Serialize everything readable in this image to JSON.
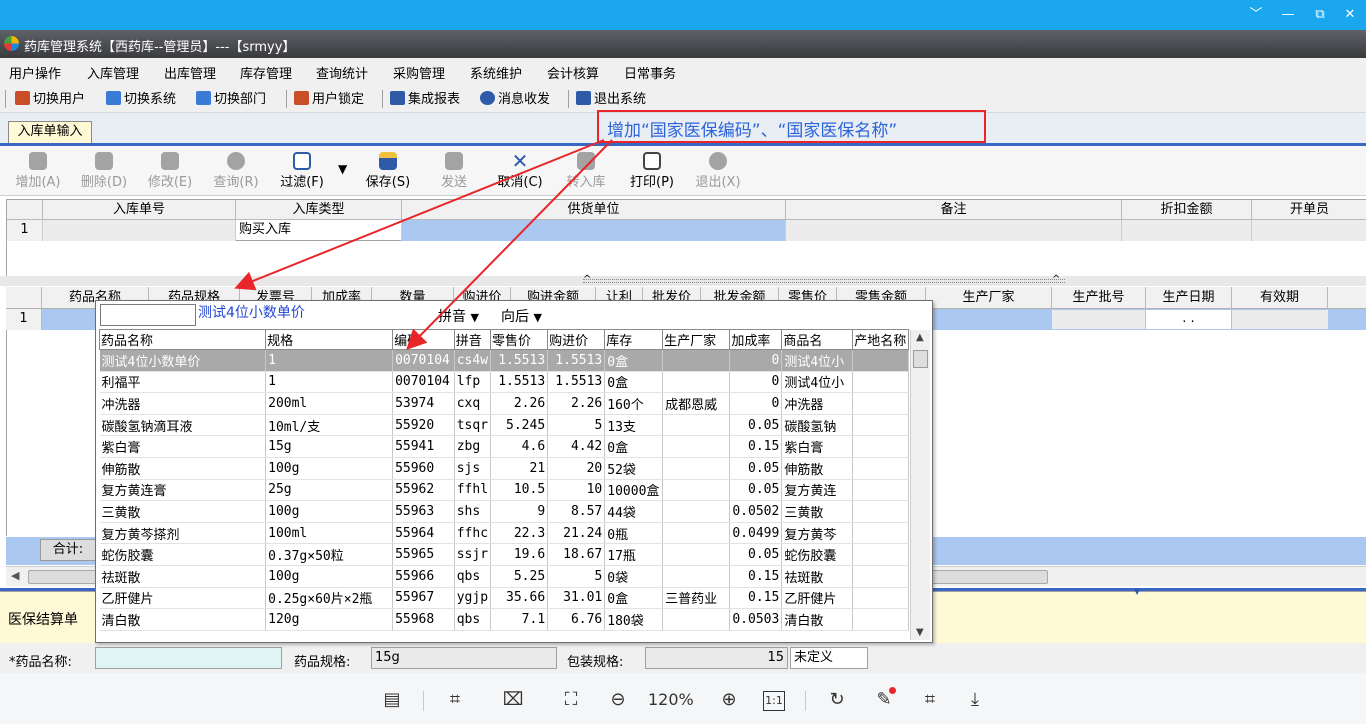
{
  "viewer": {
    "window_controls": [
      "﹀",
      "—",
      "⧉",
      "✕"
    ],
    "zoom": "120%",
    "one_to_one": "1:1"
  },
  "app": {
    "title": "药库管理系统【西药库--管理员】---【srmyy】"
  },
  "menu": [
    "用户操作",
    "入库管理",
    "出库管理",
    "库存管理",
    "查询统计",
    "采购管理",
    "系统维护",
    "会计核算",
    "日常事务"
  ],
  "quickbar": [
    {
      "label": "切换用户",
      "icon": "users-icon",
      "color": "#c94f28"
    },
    {
      "label": "切换系统",
      "icon": "switch-system-icon",
      "color": "#3a7bd5"
    },
    {
      "label": "切换部门",
      "icon": "department-icon",
      "color": "#3a7bd5"
    },
    {
      "label": "用户锁定",
      "icon": "user-lock-icon",
      "color": "#c94f28"
    },
    {
      "label": "集成报表",
      "icon": "report-icon",
      "color": "#2e5aa8"
    },
    {
      "label": "消息收发",
      "icon": "message-icon",
      "color": "#2e5aa8"
    },
    {
      "label": "退出系统",
      "icon": "exit-icon",
      "color": "#2e5aa8"
    }
  ],
  "tab": {
    "label": "入库单输入"
  },
  "annotation": {
    "text": "增加“国家医保编码”、“国家医保名称”",
    "color": "#e8262a"
  },
  "toolbar": [
    {
      "label": "增加(A)",
      "enabled": false,
      "icon": "add-icon"
    },
    {
      "label": "删除(D)",
      "enabled": false,
      "icon": "delete-icon"
    },
    {
      "label": "修改(E)",
      "enabled": false,
      "icon": "edit-icon"
    },
    {
      "label": "查询(R)",
      "enabled": false,
      "icon": "refresh-icon"
    },
    {
      "label": "过滤(F)",
      "enabled": true,
      "icon": "filter-icon"
    },
    {
      "label": "保存(S)",
      "enabled": true,
      "icon": "save-icon"
    },
    {
      "label": "发送",
      "enabled": false,
      "icon": "send-icon"
    },
    {
      "label": "取消(C)",
      "enabled": true,
      "icon": "cancel-icon"
    },
    {
      "label": "转入库",
      "enabled": false,
      "icon": "transfer-icon"
    },
    {
      "label": "打印(P)",
      "enabled": true,
      "icon": "print-icon"
    },
    {
      "label": "退出(X)",
      "enabled": false,
      "icon": "exit-icon"
    }
  ],
  "header_grid": {
    "columns": [
      "入库单号",
      "入库类型",
      "供货单位",
      "备注",
      "折扣金额",
      "开单员"
    ],
    "row": {
      "num": "1",
      "type": "购买入库"
    }
  },
  "detail_grid": {
    "columns": [
      "药品名称",
      "药品规格",
      "发票号",
      "加成率",
      "数量",
      "购进价",
      "购进金额",
      "让利",
      "批发价",
      "批发金额",
      "零售价",
      "零售金额",
      "生产厂家",
      "生产批号",
      "生产日期",
      "有效期"
    ],
    "row_num": "1",
    "date_placeholder": ". .",
    "total_label": "合计:"
  },
  "popup": {
    "caption": "测试4位小数单价",
    "pinyin_mode": "拼音",
    "direction": "向后",
    "columns": [
      "药品名称",
      "规格",
      "编码",
      "拼音",
      "零售价",
      "购进价",
      "库存",
      "生产厂家",
      "加成率",
      "商品名",
      "产地名称"
    ],
    "rows": [
      [
        "测试4位小数单价",
        "1",
        "0070104",
        "cs4w",
        "1.5513",
        "1.5513",
        "0盒",
        "",
        "0",
        "测试4位小",
        ""
      ],
      [
        "利福平",
        "1",
        "0070104",
        "lfp",
        "1.5513",
        "1.5513",
        "0盒",
        "",
        "0",
        "测试4位小",
        ""
      ],
      [
        "冲洗器",
        "200ml",
        "53974",
        "cxq",
        "2.26",
        "2.26",
        "160个",
        "成都恩威",
        "0",
        "冲洗器",
        ""
      ],
      [
        "碳酸氢钠滴耳液",
        "10ml/支",
        "55920",
        "tsqr",
        "5.245",
        "5",
        "13支",
        "",
        "0.05",
        "碳酸氢钠",
        ""
      ],
      [
        "紫白膏",
        "15g",
        "55941",
        "zbg",
        "4.6",
        "4.42",
        "0盒",
        "",
        "0.15",
        "紫白膏",
        ""
      ],
      [
        "伸筋散",
        "100g",
        "55960",
        "sjs",
        "21",
        "20",
        "52袋",
        "",
        "0.05",
        "伸筋散",
        ""
      ],
      [
        "复方黄连膏",
        "25g",
        "55962",
        "ffhl",
        "10.5",
        "10",
        "10000盒",
        "",
        "0.05",
        "复方黄连",
        ""
      ],
      [
        "三黄散",
        "100g",
        "55963",
        "shs",
        "9",
        "8.57",
        "44袋",
        "",
        "0.0502",
        "三黄散",
        ""
      ],
      [
        "复方黄芩搽剂",
        "100ml",
        "55964",
        "ffhc",
        "22.3",
        "21.24",
        "0瓶",
        "",
        "0.0499",
        "复方黄芩",
        ""
      ],
      [
        "蛇伤胶囊",
        "0.37g×50粒",
        "55965",
        "ssjr",
        "19.6",
        "18.67",
        "17瓶",
        "",
        "0.05",
        "蛇伤胶囊",
        ""
      ],
      [
        "祛斑散",
        "100g",
        "55966",
        "qbs",
        "5.25",
        "5",
        "0袋",
        "",
        "0.15",
        "祛斑散",
        ""
      ],
      [
        "乙肝健片",
        "0.25g×60片×2瓶",
        "55967",
        "ygjp",
        "35.66",
        "31.01",
        "0盒",
        "三普药业",
        "0.15",
        "乙肝健片",
        ""
      ],
      [
        "清白散",
        "120g",
        "55968",
        "qbs",
        "7.1",
        "6.76",
        "180袋",
        "",
        "0.0503",
        "清白散",
        ""
      ]
    ]
  },
  "lower_panel": {
    "tab_label": "医保结算单"
  },
  "bottom_form": {
    "drug_name_label": "*药品名称:",
    "drug_spec_label": "药品规格:",
    "drug_spec_value": "15g",
    "pack_spec_label": "包装规格:",
    "pack_spec_value": "15",
    "unit_value": "未定义"
  }
}
